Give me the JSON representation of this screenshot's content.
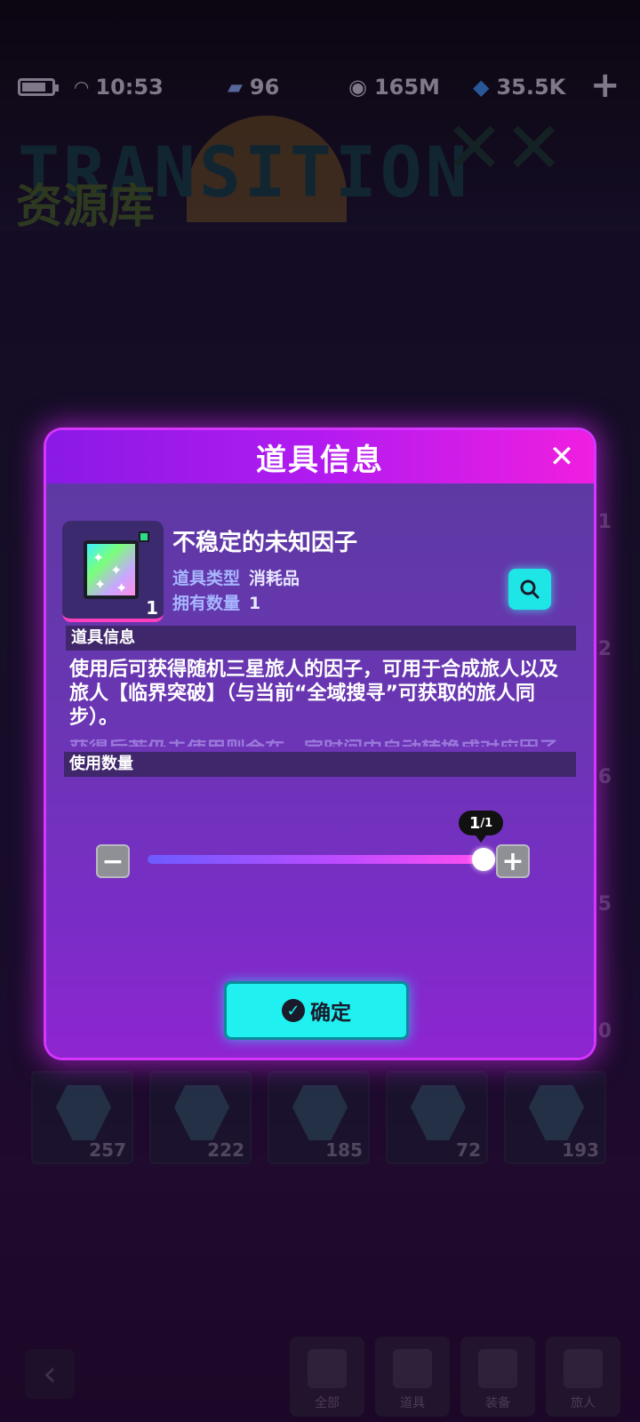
{
  "status_bar": {
    "time": "10:53",
    "stamina": "96",
    "coins": "165M",
    "gems": "35.5K"
  },
  "background": {
    "banner_text": "TRANSITION",
    "banner_cn": "资源库",
    "shop_counts": [
      "257",
      "222",
      "185",
      "72",
      "193"
    ],
    "side_counts": [
      "1",
      "2",
      "6",
      "5",
      "0"
    ],
    "nav": {
      "tab_all": "全部",
      "tab_items": "道具",
      "tab_equip": "装备",
      "tab_travelers": "旅人"
    }
  },
  "modal": {
    "title": "道具信息",
    "item_name": "不稳定的未知因子",
    "item_type_label": "道具类型",
    "item_type_value": "消耗品",
    "owned_label": "拥有数量",
    "owned_value": "1",
    "icon_count": "1",
    "section_info": "道具信息",
    "description": "使用后可获得随机三星旅人的因子，可用于合成旅人以及旅人【临界突破】（与当前“全域搜寻”可获取的旅人同步）。",
    "description_more": "获得后若仍未使用则会在一定时间内自动转换成对应因子",
    "section_quantity": "使用数量",
    "slider": {
      "value": "1",
      "max": "/1",
      "fill_fraction": 1.0
    },
    "confirm_label": "确定"
  },
  "colors": {
    "accent_cyan": "#20f0f0",
    "header_magenta": "#f01ee0",
    "modal_purple": "#6a36b3"
  }
}
